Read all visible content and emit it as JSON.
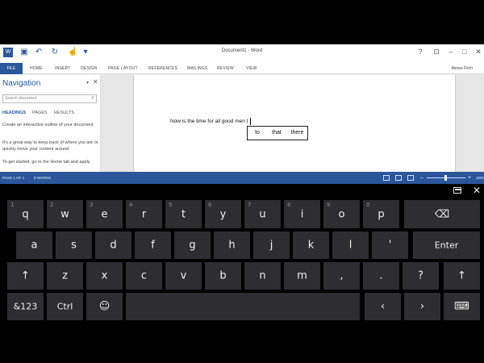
{
  "word": {
    "doc_title": "Document1 - Word",
    "tabs": [
      "FILE",
      "HOME",
      "INSERT",
      "DESIGN",
      "PAGE LAYOUT",
      "REFERENCES",
      "MAILINGS",
      "REVIEW",
      "VIEW"
    ],
    "user": "Aimee Fitch",
    "nav": {
      "title": "Navigation",
      "search_placeholder": "Search document",
      "tabs": [
        "HEADINGS",
        "PAGES",
        "RESULTS"
      ],
      "paragraphs": [
        "Create an interactive outline of your document.",
        "It's a great way to keep track of where you are or quickly move your content around.",
        "To get started, go to the Home tab and apply"
      ]
    },
    "doc_text": "Now is the time for all good men t",
    "suggestions": [
      "to",
      "that",
      "there"
    ],
    "status": {
      "page": "PAGE 1 OF 1",
      "words": "9 WORDS",
      "zoom": "100%"
    }
  },
  "keyboard": {
    "row1": [
      {
        "label": "q",
        "num": "1"
      },
      {
        "label": "w",
        "num": "2"
      },
      {
        "label": "e",
        "num": "3"
      },
      {
        "label": "r",
        "num": "4"
      },
      {
        "label": "t",
        "num": "5"
      },
      {
        "label": "y",
        "num": "6"
      },
      {
        "label": "u",
        "num": "7"
      },
      {
        "label": "i",
        "num": "8"
      },
      {
        "label": "o",
        "num": "9"
      },
      {
        "label": "p",
        "num": "0"
      }
    ],
    "row2": [
      "a",
      "s",
      "d",
      "f",
      "g",
      "h",
      "j",
      "k",
      "l",
      "'"
    ],
    "enter": "Enter",
    "row3": [
      "↑",
      "z",
      "x",
      "c",
      "v",
      "b",
      "n",
      "m",
      ",",
      ".",
      "?",
      "↑"
    ],
    "symbols": "&123",
    "ctrl": "Ctrl",
    "emoji": "☺",
    "left": "‹",
    "right": "›",
    "backspace": "⌫",
    "keyboard_icon": "⌨",
    "close": "✕"
  }
}
